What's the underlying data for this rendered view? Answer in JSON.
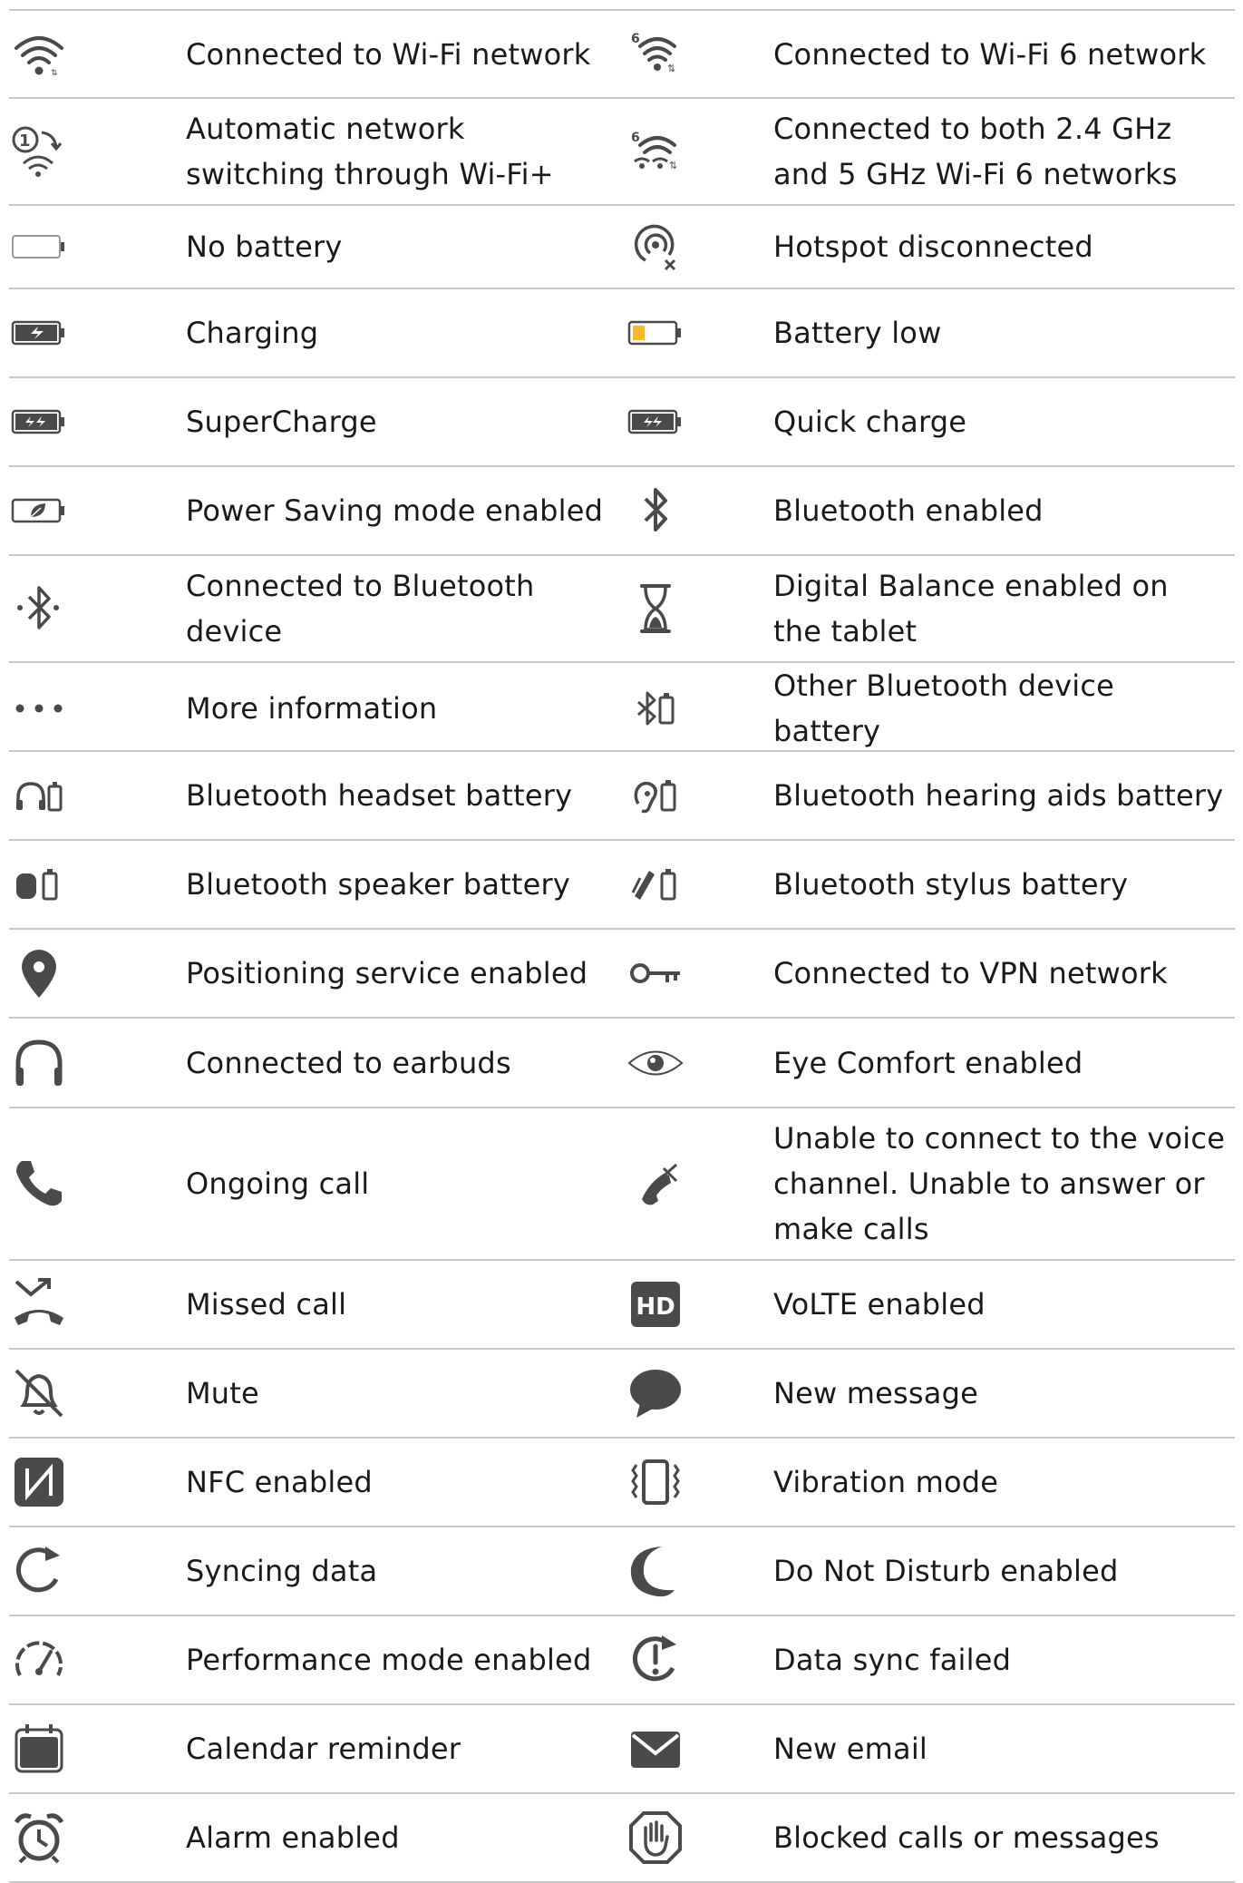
{
  "icon_color": "#4a4a4a",
  "low_battery_color": "#f5b82e",
  "rows": [
    {
      "left": {
        "icon": "wifi-icon",
        "label": "Connected to Wi-Fi network"
      },
      "right": {
        "icon": "wifi6-icon",
        "label": "Connected to Wi-Fi 6 network"
      }
    },
    {
      "left": {
        "icon": "wifi-plus-icon",
        "label": "Automatic network switching through Wi-Fi+"
      },
      "right": {
        "icon": "wifi6-dual-icon",
        "label": "Connected to both 2.4 GHz and 5 GHz Wi-Fi 6 networks"
      }
    },
    {
      "left": {
        "icon": "battery-empty-icon",
        "label": "No battery"
      },
      "right": {
        "icon": "hotspot-disconnected-icon",
        "label": "Hotspot disconnected"
      }
    },
    {
      "left": {
        "icon": "battery-charging-icon",
        "label": "Charging"
      },
      "right": {
        "icon": "battery-low-icon",
        "label": "Battery low"
      }
    },
    {
      "left": {
        "icon": "battery-supercharge-icon",
        "label": "SuperCharge"
      },
      "right": {
        "icon": "battery-quick-charge-icon",
        "label": "Quick charge"
      }
    },
    {
      "left": {
        "icon": "battery-power-saving-icon",
        "label": "Power Saving mode enabled"
      },
      "right": {
        "icon": "bluetooth-icon",
        "label": "Bluetooth enabled"
      }
    },
    {
      "left": {
        "icon": "bluetooth-connected-icon",
        "label": "Connected to Bluetooth device"
      },
      "right": {
        "icon": "hourglass-icon",
        "label": "Digital Balance enabled on the tablet"
      }
    },
    {
      "left": {
        "icon": "more-dots-icon",
        "label": "More information"
      },
      "right": {
        "icon": "bluetooth-battery-icon",
        "label": "Other Bluetooth device battery"
      }
    },
    {
      "left": {
        "icon": "headset-battery-icon",
        "label": "Bluetooth headset battery"
      },
      "right": {
        "icon": "hearing-aid-battery-icon",
        "label": "Bluetooth hearing aids battery"
      }
    },
    {
      "left": {
        "icon": "speaker-battery-icon",
        "label": "Bluetooth speaker battery"
      },
      "right": {
        "icon": "stylus-battery-icon",
        "label": "Bluetooth stylus battery"
      }
    },
    {
      "left": {
        "icon": "location-pin-icon",
        "label": "Positioning service enabled"
      },
      "right": {
        "icon": "vpn-key-icon",
        "label": "Connected to VPN network"
      }
    },
    {
      "left": {
        "icon": "earbuds-icon",
        "label": "Connected to earbuds"
      },
      "right": {
        "icon": "eye-icon",
        "label": "Eye Comfort enabled"
      }
    },
    {
      "left": {
        "icon": "phone-call-icon",
        "label": "Ongoing call"
      },
      "right": {
        "icon": "phone-no-voice-icon",
        "label": "Unable to connect to the voice channel. Unable to answer or make calls"
      }
    },
    {
      "left": {
        "icon": "missed-call-icon",
        "label": "Missed call"
      },
      "right": {
        "icon": "hd-icon",
        "label": "VoLTE enabled"
      }
    },
    {
      "left": {
        "icon": "bell-off-icon",
        "label": "Mute"
      },
      "right": {
        "icon": "message-bubble-icon",
        "label": "New message"
      }
    },
    {
      "left": {
        "icon": "nfc-icon",
        "label": "NFC enabled"
      },
      "right": {
        "icon": "vibration-icon",
        "label": "Vibration mode"
      }
    },
    {
      "left": {
        "icon": "sync-icon",
        "label": "Syncing data"
      },
      "right": {
        "icon": "moon-icon",
        "label": "Do Not Disturb enabled"
      }
    },
    {
      "left": {
        "icon": "gauge-icon",
        "label": "Performance mode enabled"
      },
      "right": {
        "icon": "sync-failed-icon",
        "label": "Data sync failed"
      }
    },
    {
      "left": {
        "icon": "calendar-icon",
        "label": "Calendar reminder"
      },
      "right": {
        "icon": "envelope-icon",
        "label": "New email"
      }
    },
    {
      "left": {
        "icon": "alarm-clock-icon",
        "label": "Alarm enabled"
      },
      "right": {
        "icon": "hand-block-icon",
        "label": "Blocked calls or messages"
      }
    }
  ]
}
